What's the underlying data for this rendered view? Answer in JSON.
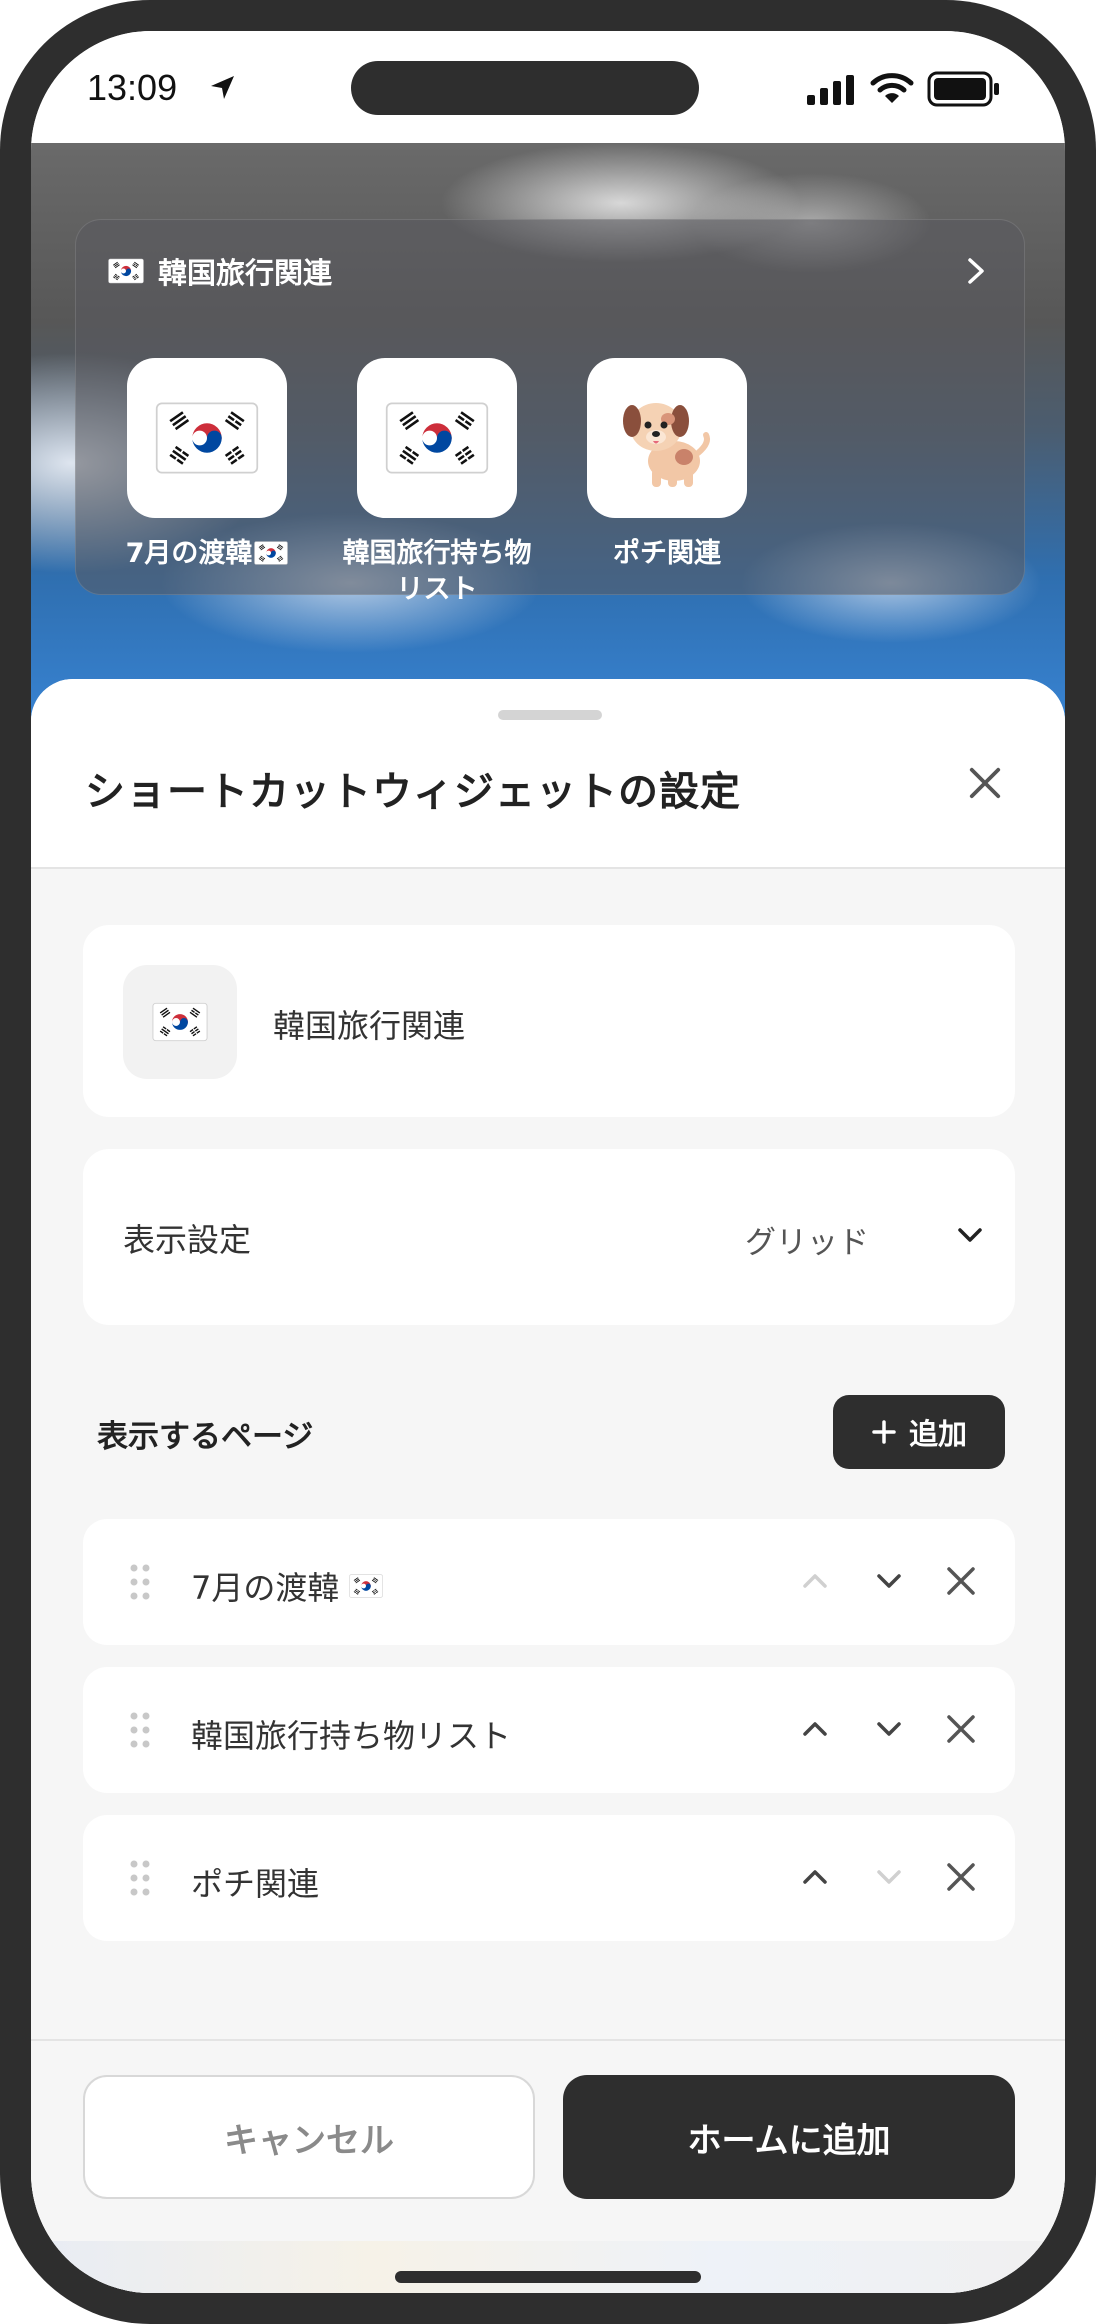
{
  "status_bar": {
    "time": "13:09"
  },
  "widget": {
    "title": "韓国旅行関連",
    "items": [
      {
        "label": "7月の渡韓",
        "icon": "korean-flag"
      },
      {
        "label": "韓国旅行持ち物リスト",
        "icon": "korean-flag"
      },
      {
        "label": "ポチ関連",
        "icon": "dog"
      }
    ]
  },
  "sheet": {
    "title": "ショートカットウィジェットの設定",
    "widget_name": "韓国旅行関連",
    "display_setting": {
      "label": "表示設定",
      "value": "グリッド"
    },
    "pages_heading": "表示するページ",
    "add_button": "追加",
    "pages": [
      {
        "label": "7月の渡韓",
        "has_flag": true,
        "up_enabled": false,
        "down_enabled": true
      },
      {
        "label": "韓国旅行持ち物リスト",
        "has_flag": false,
        "up_enabled": true,
        "down_enabled": true
      },
      {
        "label": "ポチ関連",
        "has_flag": false,
        "up_enabled": true,
        "down_enabled": false
      }
    ],
    "cancel_button": "キャンセル",
    "confirm_button": "ホームに追加"
  },
  "colors": {
    "dark": "#2e2e2e",
    "sheet_bg": "#f6f6f6",
    "card_bg": "#ffffff",
    "disabled_icon": "#cfcfcf",
    "flag_red": "#cd2e3a",
    "flag_blue": "#0047a0"
  }
}
